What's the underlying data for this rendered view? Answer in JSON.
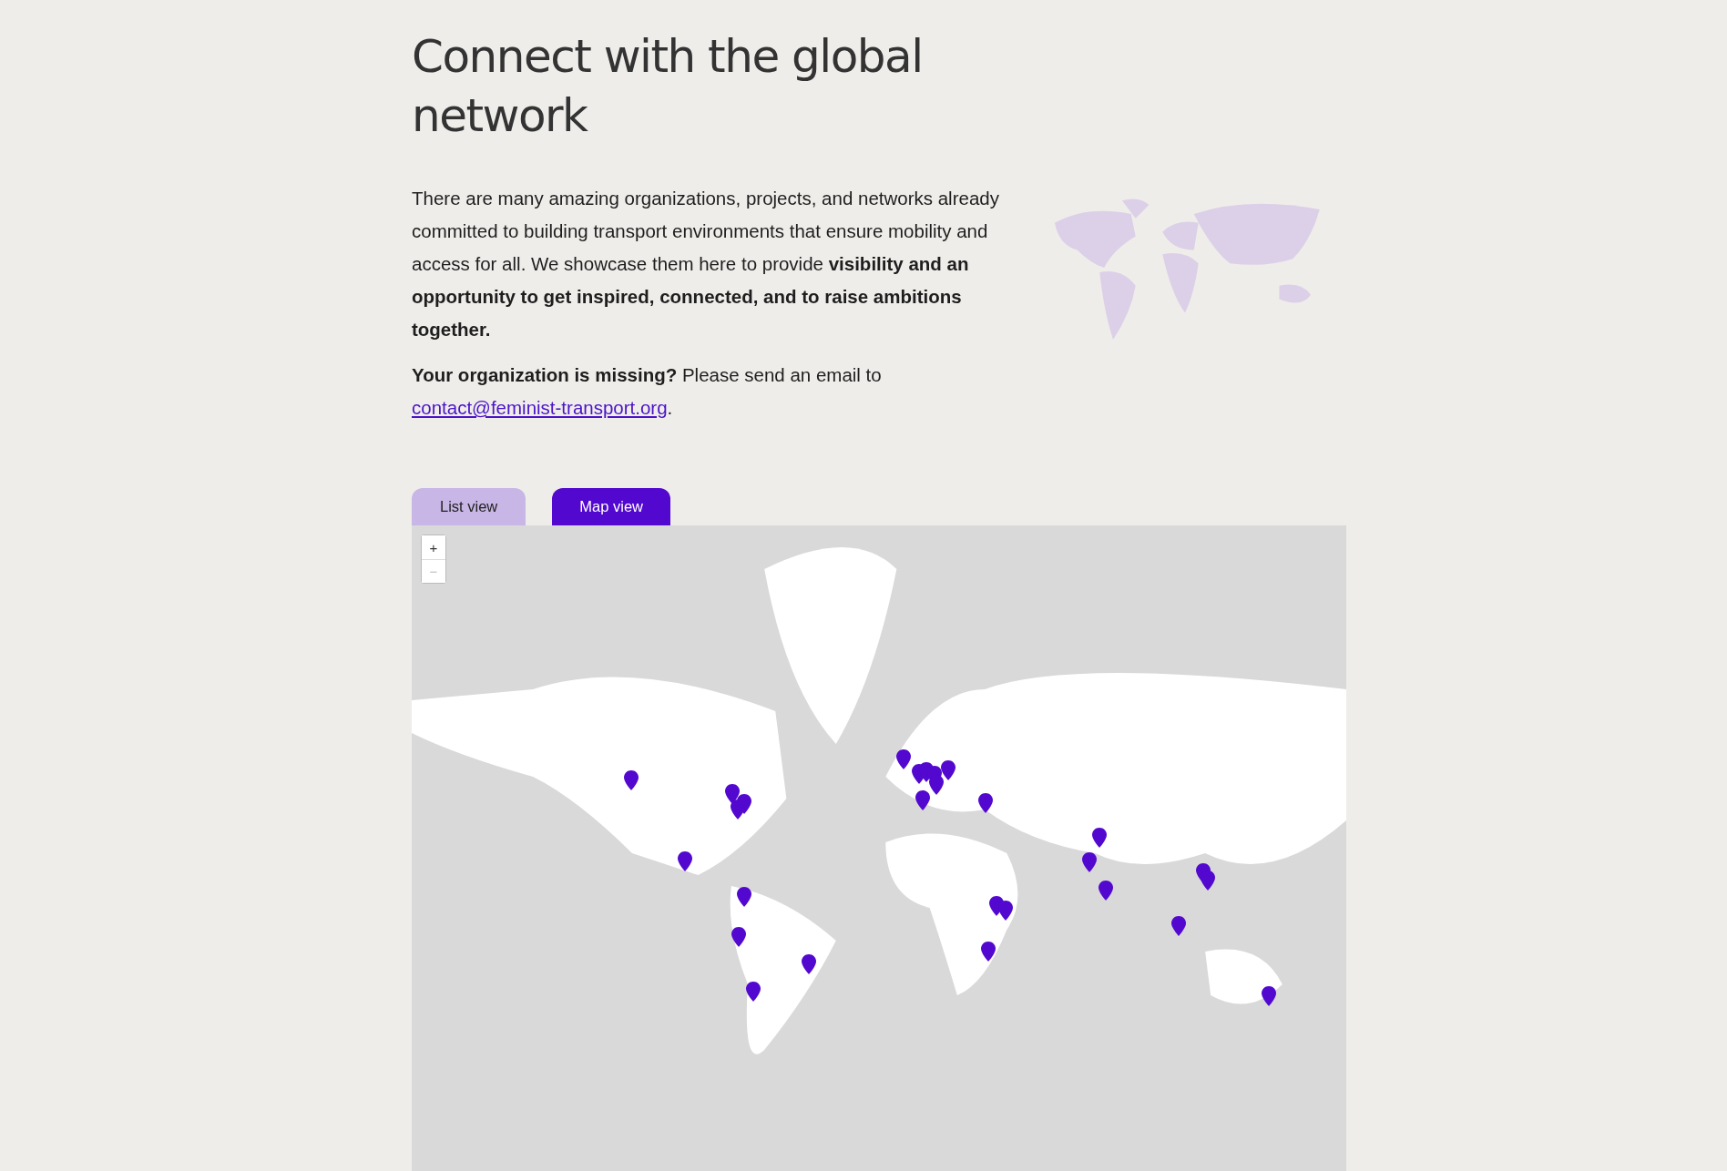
{
  "heading": "Connect with the global network",
  "intro": "There are many amazing organizations, projects, and networks already committed to building transport environments that ensure mobility and access for all. We showcase them here to provide **visibility and an opportunity to get inspired, connected, and to raise ambitions together.**",
  "missing": {
    "text": "**Your organization is missing?** Please send an email to",
    "link": "contact@feminist-transport.org",
    "end": "."
  },
  "tabs": [
    {
      "label": "List view",
      "selected": false
    },
    {
      "label": "Map view",
      "selected": true
    }
  ],
  "map": {
    "zoom_controls": [
      {
        "label": "+",
        "disabled": false
      },
      {
        "label": "−",
        "disabled": true
      }
    ]
  }
}
